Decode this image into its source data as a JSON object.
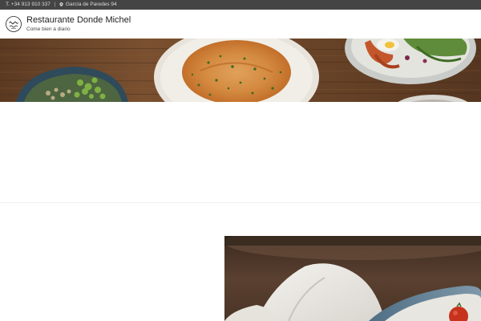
{
  "topbar": {
    "phone": "T. +34 913 910 337",
    "separator": "|",
    "address": "García de Paredes 94"
  },
  "header": {
    "logo_icon": "restaurant-logo",
    "title": "Restaurante Donde Michel",
    "tagline": "Come bien a diario"
  },
  "colors": {
    "topbar_bg": "#444444",
    "topbar_text": "#dddddd",
    "title_text": "#222222",
    "page_bg": "#ffffff"
  },
  "images": {
    "hero": "food-banner-photo",
    "secondary": "dish-photo"
  }
}
